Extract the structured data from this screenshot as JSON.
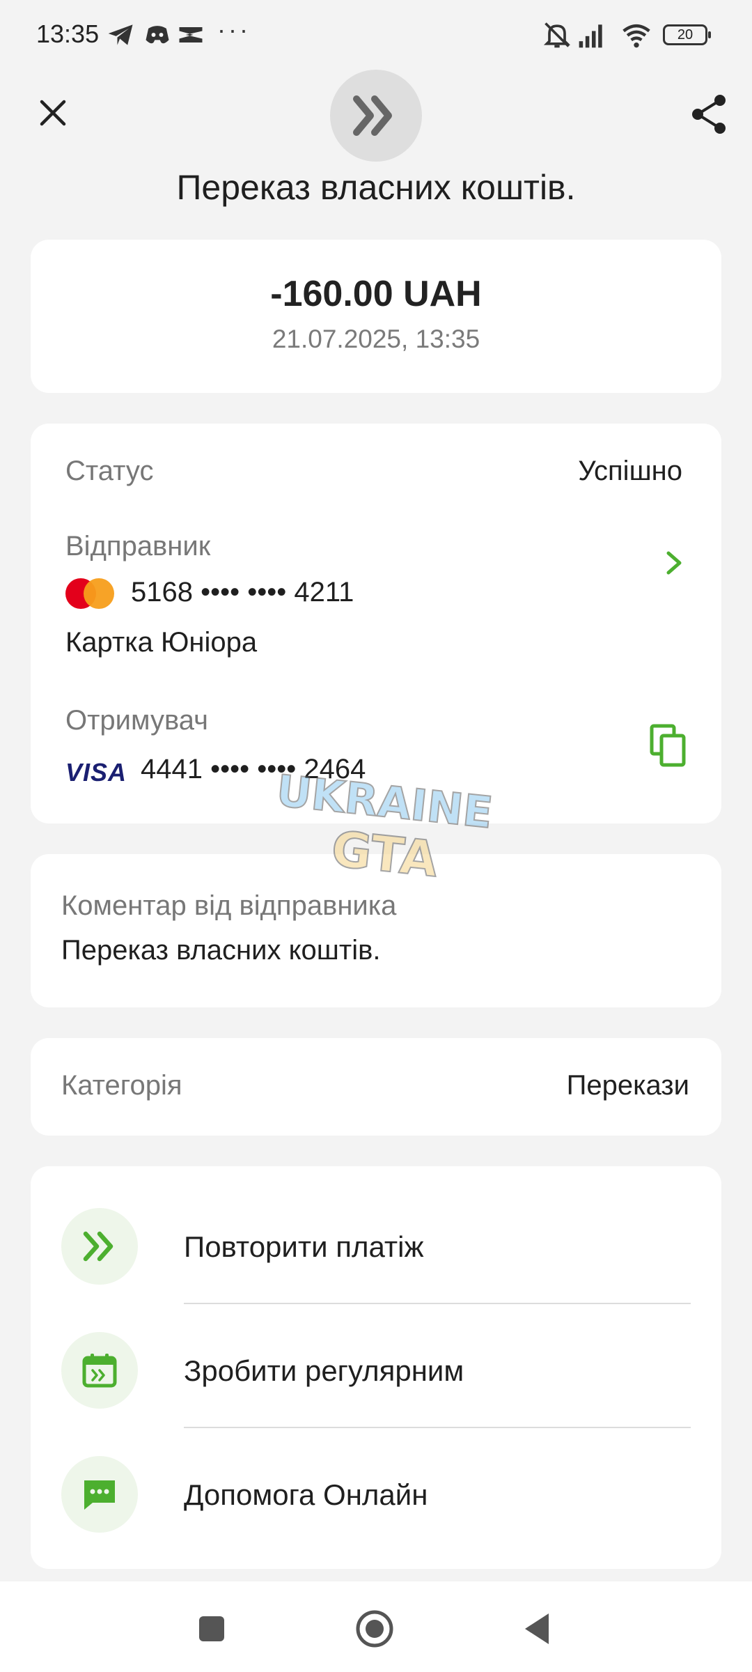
{
  "status_bar": {
    "time": "13:35",
    "dots": "···",
    "battery": "20",
    "icons": [
      "telegram-icon",
      "discord-icon",
      "capcut-icon",
      "mute-bell-icon",
      "signal-icon",
      "wifi-icon",
      "battery-icon"
    ]
  },
  "header": {
    "title": "Переказ власних коштів.",
    "icon": "double-chevron-right-icon"
  },
  "amount_card": {
    "amount": "-160.00 UAH",
    "datetime": "21.07.2025, 13:35"
  },
  "details": {
    "status_label": "Статус",
    "status_value": "Успішно",
    "sender_label": "Відправник",
    "sender_card": "5168 •••• •••• 4211",
    "sender_card_name": "Картка Юніора",
    "recipient_label": "Отримувач",
    "recipient_card": "4441 •••• •••• 2464",
    "recipient_brand": "VISA"
  },
  "comment": {
    "label": "Коментар від відправника",
    "text": "Переказ власних коштів."
  },
  "category": {
    "label": "Категорія",
    "value": "Перекази"
  },
  "actions": [
    {
      "label": "Повторити платіж",
      "icon": "repeat-payment-icon"
    },
    {
      "label": "Зробити регулярним",
      "icon": "calendar-icon"
    },
    {
      "label": "Допомога Онлайн",
      "icon": "chat-icon"
    }
  ],
  "watermark": {
    "line1": "UKRAINE",
    "line2": "GTA"
  },
  "colors": {
    "accent": "#4caf2f",
    "background": "#f3f3f3",
    "card": "#ffffff",
    "muted_text": "#777777",
    "mastercard_red": "#e3001b",
    "mastercard_orange": "#f79e1b",
    "visa_blue": "#1a1f71"
  }
}
